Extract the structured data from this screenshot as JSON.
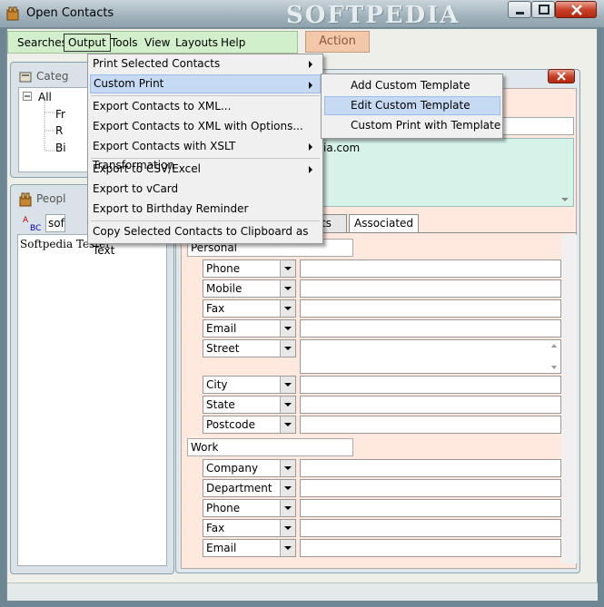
{
  "window": {
    "title": "Open Contacts",
    "watermark": "SOFTPEDIA"
  },
  "menubar": [
    {
      "label": "Searches"
    },
    {
      "label": "Output"
    },
    {
      "label": "Tools"
    },
    {
      "label": "View"
    },
    {
      "label": "Layouts"
    },
    {
      "label": "Help"
    }
  ],
  "toolbar": {
    "action_label": "Action"
  },
  "categories": {
    "title": "Categ",
    "items": [
      "All",
      "Fr",
      "R",
      "Bi"
    ]
  },
  "people": {
    "title": "Peopl",
    "search_value": "sof",
    "items": [
      "Softpedia Tester"
    ]
  },
  "detail": {
    "email_partial": "ia.com",
    "tabs": [
      "acts",
      "Associated"
    ],
    "personal_label": "Personal",
    "work_label": "Work",
    "personal_fields": [
      "Phone",
      "Mobile",
      "Fax",
      "Email",
      "Street",
      "City",
      "State",
      "Postcode"
    ],
    "work_fields": [
      "Company",
      "Department",
      "Phone",
      "Fax",
      "Email"
    ]
  },
  "output_menu": [
    "Print Selected Contacts",
    "Custom Print",
    "Export Contacts to XML...",
    "Export Contacts to XML with Options...",
    "Export Contacts with XSLT Transformation",
    "Export to CSV/Excel",
    "Export to vCard",
    "Export to Birthday Reminder",
    "Copy Selected Contacts to Clipboard as Text"
  ],
  "custom_print_submenu": [
    "Add Custom Template",
    "Edit Custom Template",
    "Custom Print with Template"
  ],
  "colors": {
    "accent_green": "#d2efcc",
    "highlight": "#c6daf3",
    "form_bg": "#ffe9de"
  }
}
